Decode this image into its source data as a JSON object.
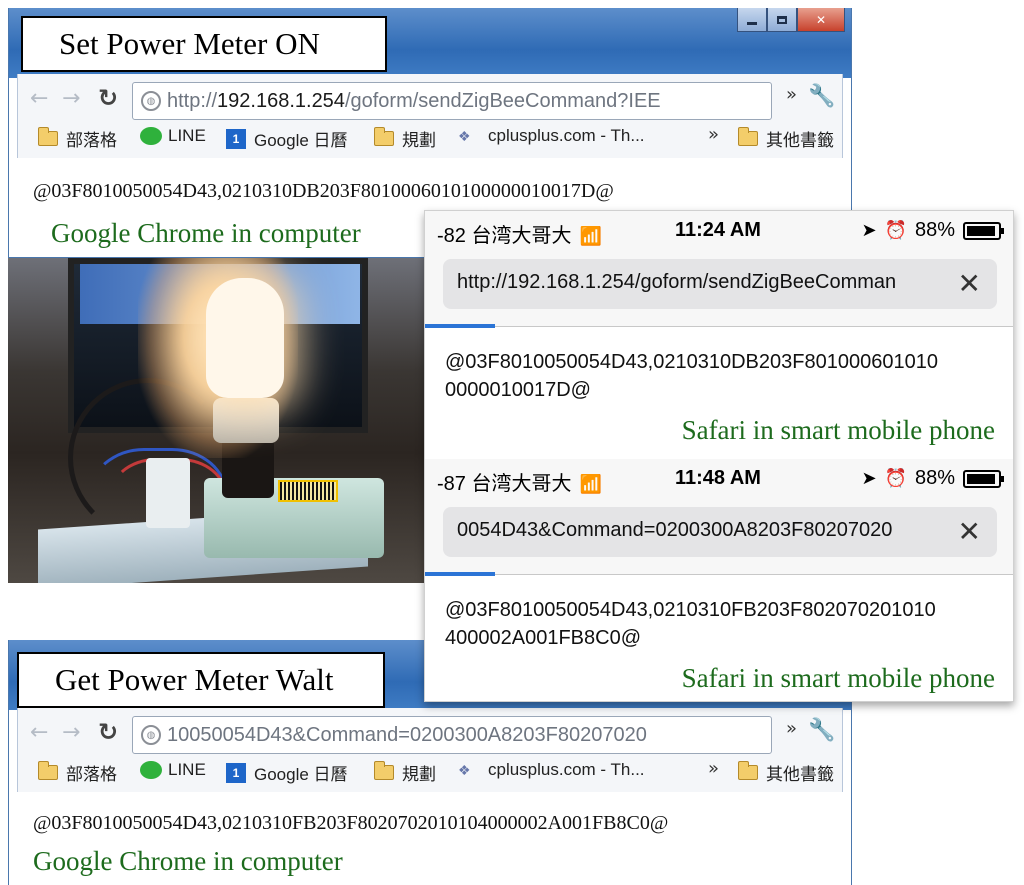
{
  "top_window": {
    "label": "Set Power Meter ON",
    "url_prefix": "http://",
    "url_host": "192.168.1.254",
    "url_rest": "/goform/sendZigBeeCommand?IEE",
    "response": "@03F8010050054D43,0210310DB203F8010006010100000010017D@",
    "caption": "Google Chrome in computer"
  },
  "bottom_window": {
    "label": "Get Power Meter Walt",
    "url_text": "10050054D43&Command=0200300A8203F80207020",
    "response": "@03F8010050054D43,0210310FB203F8020702010104000002A001FB8C0@",
    "caption": "Google Chrome in computer"
  },
  "bookmarks": [
    {
      "label": "部落格",
      "icon": "folder-icon"
    },
    {
      "label": "LINE",
      "icon": "line-icon"
    },
    {
      "label": "Google 日曆",
      "icon": "google-calendar-icon"
    },
    {
      "label": "規劃",
      "icon": "folder-icon"
    },
    {
      "label": "cplusplus.com - Th...",
      "icon": "cplusplus-icon"
    },
    {
      "label": "其他書籤",
      "icon": "folder-icon"
    }
  ],
  "calendar_icon_text": "1",
  "phone1": {
    "carrier": "-82 台湾大哥大",
    "time": "11:24 AM",
    "battery": "88%",
    "url": "http://192.168.1.254/goform/sendZigBeeComman",
    "response_line1": "@03F8010050054D43,0210310DB203F801000601010",
    "response_line2": "0000010017D@",
    "caption": "Safari in smart mobile phone"
  },
  "phone2": {
    "carrier": "-87 台湾大哥大",
    "time": "11:48 AM",
    "battery": "88%",
    "url": "0054D43&Command=0200300A8203F80207020",
    "response_line1": "@03F8010050054D43,0210310FB203F802070201010",
    "response_line2": "400002A001FB8C0@",
    "caption": "Safari in smart mobile phone"
  },
  "colors": {
    "caption_green": "#1d6b1d",
    "titlebar_blue": "#2f6bb5",
    "progress_blue": "#2b74d6"
  }
}
